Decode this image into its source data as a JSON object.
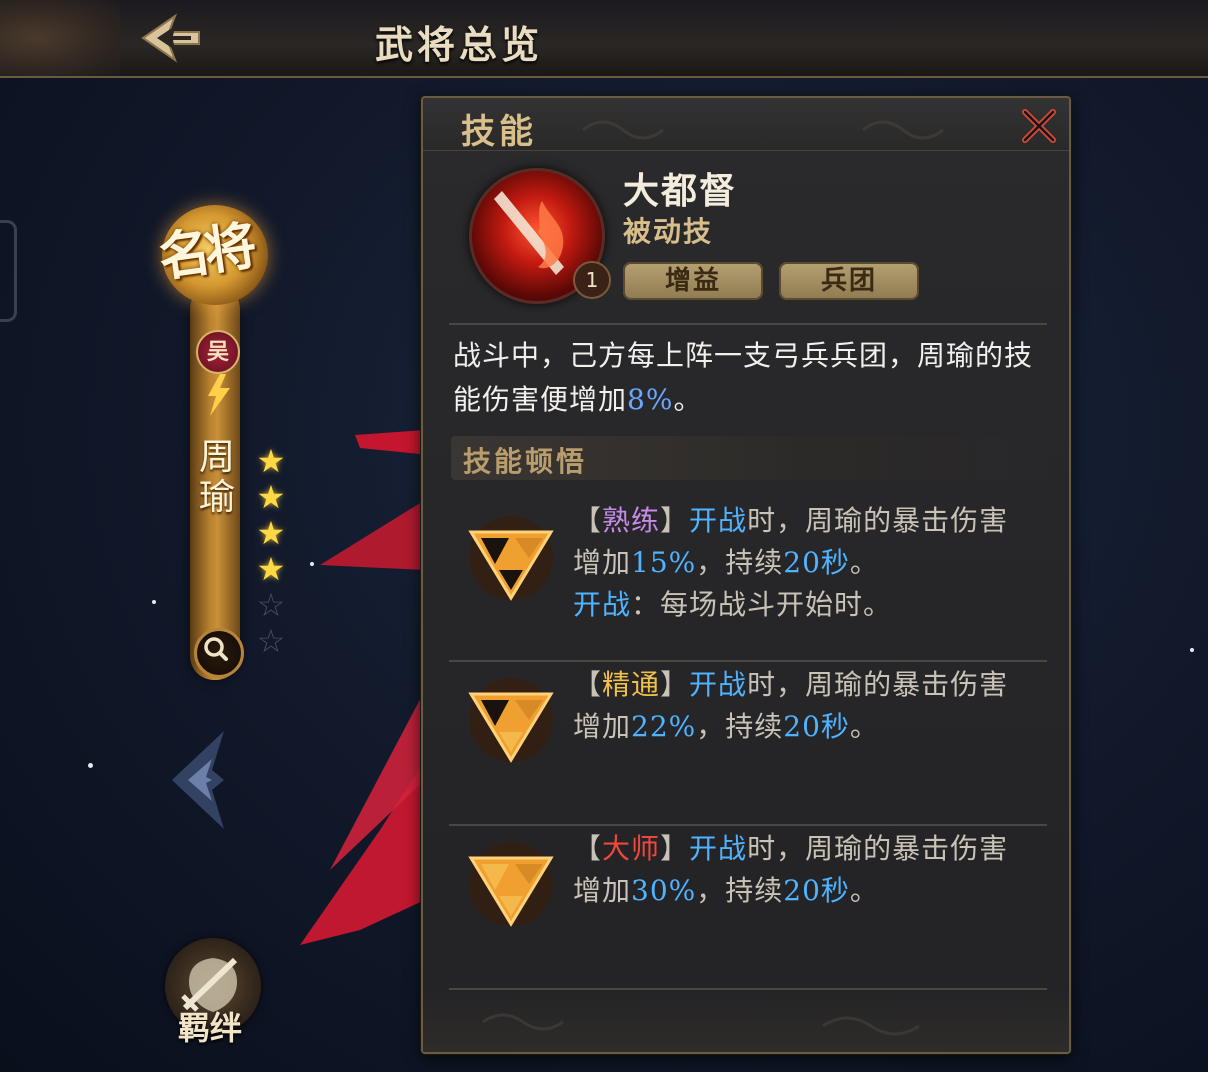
{
  "header": {
    "title": "武将总览"
  },
  "hero": {
    "rank_label": "名将",
    "kingdom": "吴",
    "name": "周瑜",
    "stars_filled": 4,
    "stars_total": 6,
    "bond_label": "羁绊"
  },
  "skill_panel": {
    "title": "技能",
    "skill_name": "大都督",
    "skill_type": "被动技",
    "level": "1",
    "tags": [
      "增益",
      "兵团"
    ],
    "description_parts": [
      "战斗中，己方每上阵一支弓兵兵团，周瑜的技能伤害便增加",
      "8%",
      "。"
    ],
    "insight_header": "技能顿悟",
    "insights": [
      {
        "level_name": "熟练",
        "keyword": "开战",
        "text_a": "时，周瑜的暴击伤害增加",
        "percent": "15%",
        "text_b": "，持续",
        "duration": "20秒",
        "text_c": "。",
        "note_keyword": "开战",
        "note_text": "：每场战斗开始时。",
        "color": "#c68ae8"
      },
      {
        "level_name": "精通",
        "keyword": "开战",
        "text_a": "时，周瑜的暴击伤害增加",
        "percent": "22%",
        "text_b": "，持续",
        "duration": "20秒",
        "text_c": "。",
        "color": "#f0c04a"
      },
      {
        "level_name": "大师",
        "keyword": "开战",
        "text_a": "时，周瑜的暴击伤害增加",
        "percent": "30%",
        "text_b": "，持续",
        "duration": "20秒",
        "text_c": "。",
        "color": "#f0473c"
      }
    ]
  },
  "icons": {
    "back": "back-arrow-icon",
    "close": "close-icon",
    "search": "magnifier-icon",
    "bond": "shield-sword-icon",
    "insight": "triangle-gem-icon"
  },
  "colors": {
    "highlight_blue": "#68a7ff",
    "keyword_blue": "#4fb3ff",
    "gold_text": "#d9bf8a"
  }
}
